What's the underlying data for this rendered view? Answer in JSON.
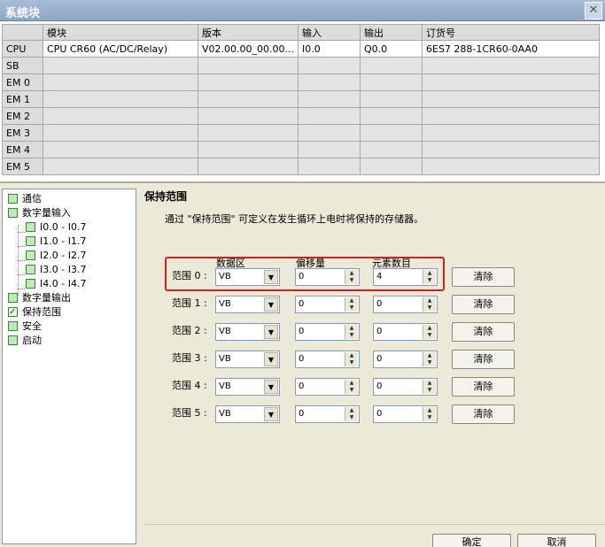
{
  "window": {
    "title": "系统块",
    "close_glyph": "✕"
  },
  "grid": {
    "headers": [
      "",
      "模块",
      "版本",
      "输入",
      "输出",
      "订货号"
    ],
    "rows": [
      [
        "CPU",
        "CPU CR60 (AC/DC/Relay)",
        "V02.00.00_00.00...",
        "I0.0",
        "Q0.0",
        "6ES7 288-1CR60-0AA0"
      ],
      [
        "SB",
        "",
        "",
        "",
        "",
        ""
      ],
      [
        "EM 0",
        "",
        "",
        "",
        "",
        ""
      ],
      [
        "EM 1",
        "",
        "",
        "",
        "",
        ""
      ],
      [
        "EM 2",
        "",
        "",
        "",
        "",
        ""
      ],
      [
        "EM 3",
        "",
        "",
        "",
        "",
        ""
      ],
      [
        "EM 4",
        "",
        "",
        "",
        "",
        ""
      ],
      [
        "EM 5",
        "",
        "",
        "",
        "",
        ""
      ]
    ]
  },
  "tree": {
    "items": [
      {
        "label": "通信",
        "checked": false
      },
      {
        "label": "数字量输入",
        "checked": false
      },
      {
        "label": "I0.0 - I0.7",
        "checked": false
      },
      {
        "label": "I1.0 - I1.7",
        "checked": false
      },
      {
        "label": "I2.0 - I2.7",
        "checked": false
      },
      {
        "label": "I3.0 - I3.7",
        "checked": false
      },
      {
        "label": "I4.0 - I4.7",
        "checked": false
      },
      {
        "label": "数字量输出",
        "checked": false
      },
      {
        "label": "保持范围",
        "checked": true
      },
      {
        "label": "安全",
        "checked": false
      },
      {
        "label": "启动",
        "checked": false
      }
    ]
  },
  "retentive": {
    "heading": "保持范围",
    "description": "通过 \"保持范围\" 可定义在发生循环上电时将保持的存储器。",
    "col_area": "数据区",
    "col_offset": "偏移量",
    "col_count": "元素数目",
    "ranges": [
      {
        "label": "范围 0 :",
        "area": "VB",
        "offset": "0",
        "count": "4",
        "clear": "清除"
      },
      {
        "label": "范围 1 :",
        "area": "VB",
        "offset": "0",
        "count": "0",
        "clear": "清除"
      },
      {
        "label": "范围 2 :",
        "area": "VB",
        "offset": "0",
        "count": "0",
        "clear": "清除"
      },
      {
        "label": "范围 3 :",
        "area": "VB",
        "offset": "0",
        "count": "0",
        "clear": "清除"
      },
      {
        "label": "范围 4 :",
        "area": "VB",
        "offset": "0",
        "count": "0",
        "clear": "清除"
      },
      {
        "label": "范围 5 :",
        "area": "VB",
        "offset": "0",
        "count": "0",
        "clear": "清除"
      }
    ]
  },
  "footer": {
    "ok": "确定",
    "cancel": "取消"
  },
  "colors": {
    "highlight": "#d0201e",
    "tree_check": "#2f8a2f"
  }
}
